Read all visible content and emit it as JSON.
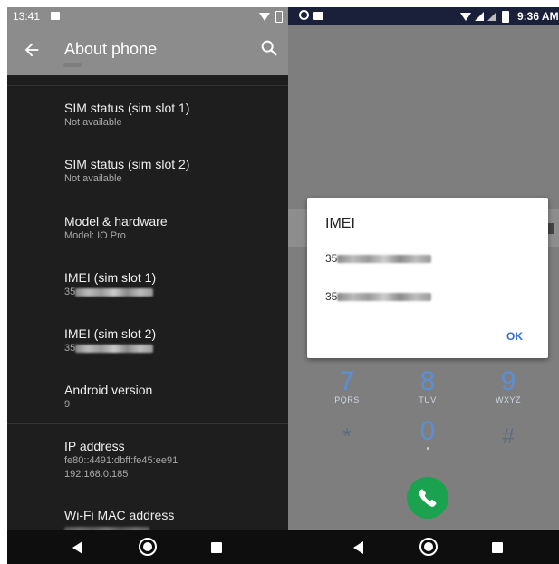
{
  "left": {
    "status_time": "13:41",
    "title": "About phone",
    "items": [
      {
        "title": "SIM status (sim slot 1)",
        "sub": "Not available"
      },
      {
        "title": "SIM status (sim slot 2)",
        "sub": "Not available"
      },
      {
        "title": "Model & hardware",
        "sub": "Model: IO Pro"
      },
      {
        "title": "IMEI (sim slot 1)",
        "sub": "35"
      },
      {
        "title": "IMEI (sim slot 2)",
        "sub": "35"
      },
      {
        "title": "Android version",
        "sub": "9"
      },
      {
        "title": "IP address",
        "sub": "fe80::4491:dbff:fe45:ee91\n192.168.0.185"
      },
      {
        "title": "Wi-Fi MAC address",
        "sub": ""
      }
    ]
  },
  "right": {
    "status_time": "9:36 AM",
    "dialog": {
      "title": "IMEI",
      "imei_1": "35",
      "imei_2": "35",
      "ok": "OK"
    },
    "keys": [
      {
        "digit": "7",
        "letters": "PQRS"
      },
      {
        "digit": "8",
        "letters": "TUV"
      },
      {
        "digit": "9",
        "letters": "WXYZ"
      },
      {
        "digit": "*",
        "letters": ""
      },
      {
        "digit": "0",
        "letters": ""
      },
      {
        "digit": "#",
        "letters": ""
      }
    ]
  },
  "icons": [
    "back-arrow-icon",
    "search-icon",
    "nav-back-icon",
    "nav-home-icon",
    "nav-recents-icon",
    "phone-icon"
  ]
}
